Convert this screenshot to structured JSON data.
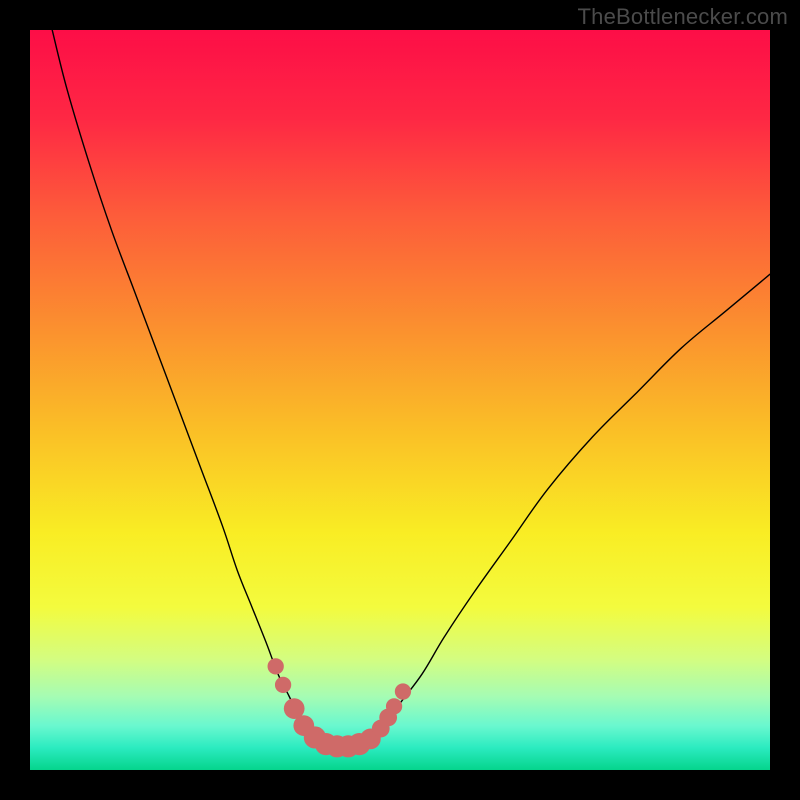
{
  "credit": "TheBottlenecker.com",
  "colors": {
    "bg": "#000000",
    "credit": "#4b4b4b",
    "curve": "#000000",
    "dot": "#cf6a68",
    "gradient_stops": [
      {
        "offset": 0.0,
        "color": "#fd0e47"
      },
      {
        "offset": 0.12,
        "color": "#fe2844"
      },
      {
        "offset": 0.25,
        "color": "#fd5c3a"
      },
      {
        "offset": 0.4,
        "color": "#fb8f2f"
      },
      {
        "offset": 0.55,
        "color": "#fac226"
      },
      {
        "offset": 0.68,
        "color": "#f9ed24"
      },
      {
        "offset": 0.78,
        "color": "#f3fb3e"
      },
      {
        "offset": 0.85,
        "color": "#d4fd80"
      },
      {
        "offset": 0.9,
        "color": "#a6fcb3"
      },
      {
        "offset": 0.94,
        "color": "#6af8cf"
      },
      {
        "offset": 0.97,
        "color": "#2bebc0"
      },
      {
        "offset": 1.0,
        "color": "#05d58c"
      }
    ]
  },
  "chart_data": {
    "type": "line",
    "title": "",
    "xlabel": "",
    "ylabel": "",
    "xlim": [
      0,
      100
    ],
    "ylim": [
      0,
      100
    ],
    "grid": false,
    "series": [
      {
        "name": "left-curve",
        "x": [
          3,
          5,
          8,
          11,
          14,
          17,
          20,
          23,
          26,
          28,
          30,
          32,
          33.5,
          35,
          36.5,
          38,
          39
        ],
        "y": [
          100,
          92,
          82,
          73,
          65,
          57,
          49,
          41,
          33,
          27,
          22,
          17,
          13,
          10,
          7,
          5,
          4
        ]
      },
      {
        "name": "right-curve",
        "x": [
          46,
          48,
          50,
          53,
          56,
          60,
          65,
          70,
          76,
          82,
          88,
          94,
          100
        ],
        "y": [
          4,
          6,
          9,
          13,
          18,
          24,
          31,
          38,
          45,
          51,
          57,
          62,
          67
        ]
      },
      {
        "name": "trough",
        "x": [
          39,
          40,
          41,
          42,
          43,
          44,
          45,
          46
        ],
        "y": [
          4,
          3.4,
          3.2,
          3.1,
          3.1,
          3.2,
          3.4,
          4
        ]
      }
    ],
    "dots": [
      {
        "x": 33.2,
        "y": 14,
        "r": 1.1
      },
      {
        "x": 34.2,
        "y": 11.5,
        "r": 1.1
      },
      {
        "x": 35.7,
        "y": 8.3,
        "r": 1.4
      },
      {
        "x": 37.0,
        "y": 6.0,
        "r": 1.4
      },
      {
        "x": 38.5,
        "y": 4.4,
        "r": 1.5
      },
      {
        "x": 40.0,
        "y": 3.5,
        "r": 1.5
      },
      {
        "x": 41.5,
        "y": 3.2,
        "r": 1.5
      },
      {
        "x": 43.0,
        "y": 3.2,
        "r": 1.5
      },
      {
        "x": 44.5,
        "y": 3.5,
        "r": 1.5
      },
      {
        "x": 46.0,
        "y": 4.2,
        "r": 1.4
      },
      {
        "x": 47.4,
        "y": 5.6,
        "r": 1.2
      },
      {
        "x": 48.4,
        "y": 7.1,
        "r": 1.2
      },
      {
        "x": 49.2,
        "y": 8.6,
        "r": 1.1
      },
      {
        "x": 50.4,
        "y": 10.6,
        "r": 1.1
      }
    ]
  }
}
